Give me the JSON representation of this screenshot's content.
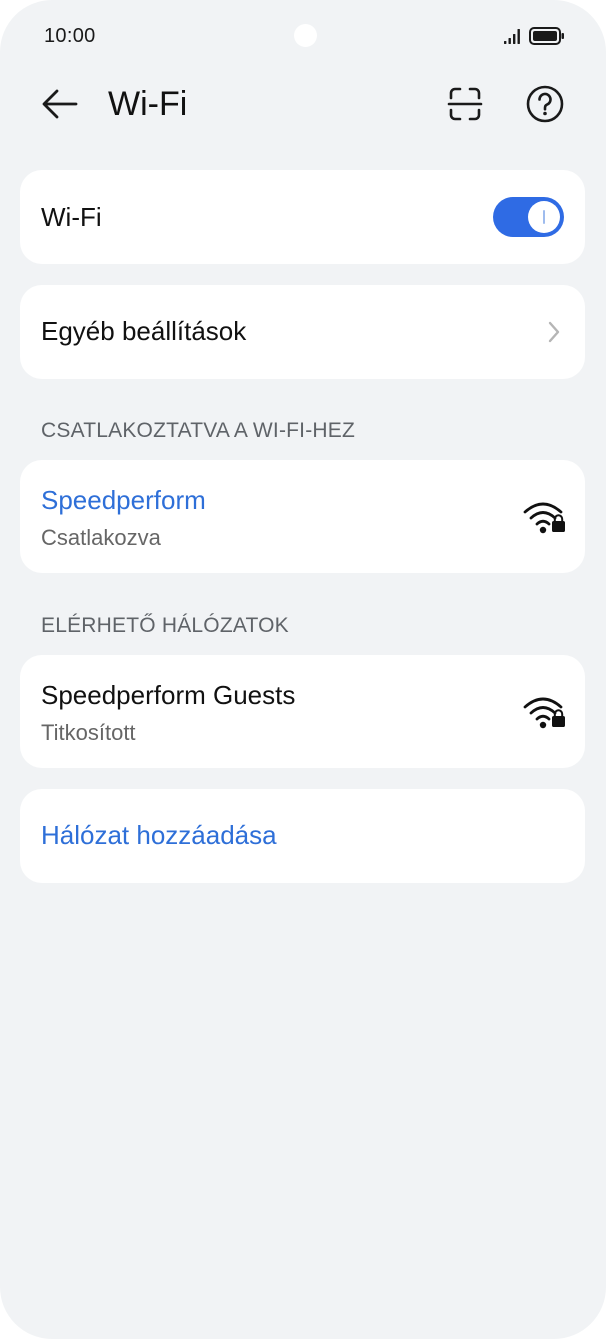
{
  "status_bar": {
    "time": "10:00",
    "icons": [
      "signal-icon",
      "battery-icon"
    ]
  },
  "header": {
    "title": "Wi-Fi",
    "icons": [
      "back-arrow-icon",
      "scan-icon",
      "help-icon"
    ]
  },
  "wifi_toggle": {
    "label": "Wi-Fi",
    "state": "on"
  },
  "other_settings": {
    "label": "Egyéb beállítások",
    "icon": "chevron-right-icon"
  },
  "connected_section": {
    "header": "CSATLAKOZTATVA A WI-FI-HEZ",
    "network": {
      "name": "Speedperform",
      "status": "Csatlakozva",
      "icon": "wifi-locked-icon"
    }
  },
  "available_section": {
    "header": "ELÉRHETŐ HÁLÓZATOK",
    "network": {
      "name": "Speedperform Guests",
      "status": "Titkosított",
      "icon": "wifi-locked-icon"
    }
  },
  "add_network": {
    "label": "Hálózat hozzáadása"
  },
  "colors": {
    "accent": "#2f6be4",
    "link_blue": "#2e6fd8",
    "background": "#f1f3f5",
    "card": "#ffffff",
    "secondary_text": "#666666"
  }
}
